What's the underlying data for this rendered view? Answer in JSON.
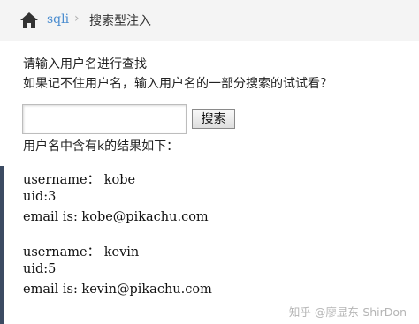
{
  "breadcrumb": {
    "home_icon": "home-icon",
    "link": "sqli",
    "separator": "›",
    "current": "搜索型注入"
  },
  "form": {
    "prompt_line1": "请输入用户名进行查找",
    "prompt_line2": "如果记不住用户名，输入用户名的一部分搜索的试试看？",
    "input_value": "",
    "button_label": "搜索"
  },
  "results": {
    "heading": "用户名中含有k的结果如下：",
    "items": [
      {
        "username": "username：  kobe",
        "uid": "uid:3",
        "email": "email is: kobe@pikachu.com"
      },
      {
        "username": "username：  kevin",
        "uid": "uid:5",
        "email": "email is: kevin@pikachu.com"
      }
    ]
  },
  "watermark": "知乎 @廖显东-ShirDon",
  "colors": {
    "link": "#4a8ccf",
    "breadcrumb_bg": "#f4f4f4",
    "left_rule": "#3c4b62"
  }
}
